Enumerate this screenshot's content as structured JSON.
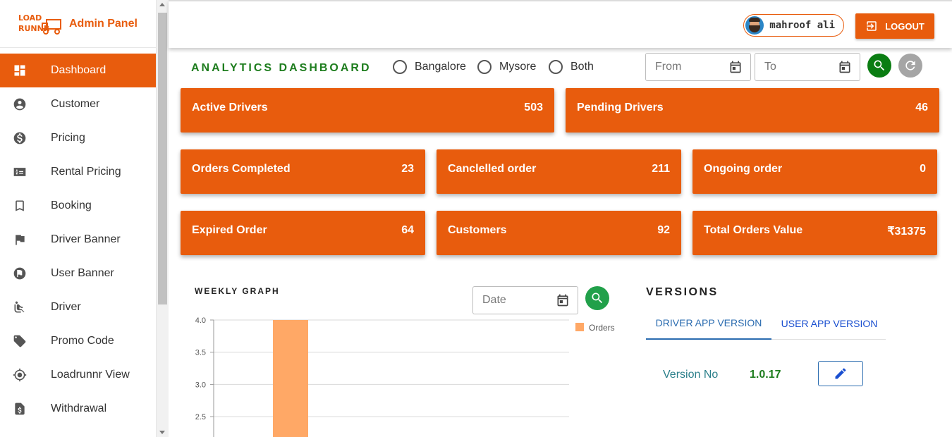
{
  "brand": {
    "title": "Admin Panel",
    "logo_text": "LOADRUNNR"
  },
  "sidebar": {
    "items": [
      {
        "label": "Dashboard",
        "icon": "dashboard-icon",
        "active": true
      },
      {
        "label": "Customer",
        "icon": "account-circle-icon"
      },
      {
        "label": "Pricing",
        "icon": "dollar-circle-icon"
      },
      {
        "label": "Rental Pricing",
        "icon": "dollar-card-icon"
      },
      {
        "label": "Booking",
        "icon": "bookmark-icon"
      },
      {
        "label": "Driver Banner",
        "icon": "flag-icon"
      },
      {
        "label": "User Banner",
        "icon": "flag-circle-icon"
      },
      {
        "label": "Driver",
        "icon": "seat-icon"
      },
      {
        "label": "Promo Code",
        "icon": "tag-icon"
      },
      {
        "label": "Loadrunnr View",
        "icon": "target-icon"
      },
      {
        "label": "Withdrawal",
        "icon": "dollar-document-icon"
      }
    ]
  },
  "header": {
    "user_name": "mahroof ali",
    "logout_label": "LOGOUT"
  },
  "dashboard": {
    "title": "ANALYTICS DASHBOARD",
    "cities": [
      "Bangalore",
      "Mysore",
      "Both"
    ],
    "from_placeholder": "From",
    "to_placeholder": "To",
    "accent_color": "#e85c0d",
    "search_color": "#0a7d12",
    "reset_color": "#a5a5a5"
  },
  "cards": [
    {
      "label": "Active Drivers",
      "value": "503"
    },
    {
      "label": "Pending Drivers",
      "value": "46"
    },
    {
      "label": "Orders Completed",
      "value": "23"
    },
    {
      "label": "Canclelled order",
      "value": "211"
    },
    {
      "label": "Ongoing order",
      "value": "0"
    },
    {
      "label": "Expired Order",
      "value": "64"
    },
    {
      "label": "Customers",
      "value": "92"
    },
    {
      "label": "Total Orders Value",
      "value": "₹31375"
    }
  ],
  "graph": {
    "title": "WEEKLY GRAPH",
    "date_placeholder": "Date"
  },
  "chart_data": {
    "type": "bar",
    "series": [
      {
        "name": "Orders",
        "values": [
          4
        ]
      }
    ],
    "yticks": [
      "4.0",
      "3.5",
      "3.0",
      "2.5"
    ],
    "ylim": [
      2.5,
      4.0
    ],
    "grid": true,
    "legend": "right",
    "bar_color": "#ffa866"
  },
  "versions": {
    "title": "VERSIONS",
    "tabs": [
      "DRIVER APP VERSION",
      "USER APP VERSION"
    ],
    "label": "Version No",
    "value": "1.0.17"
  }
}
